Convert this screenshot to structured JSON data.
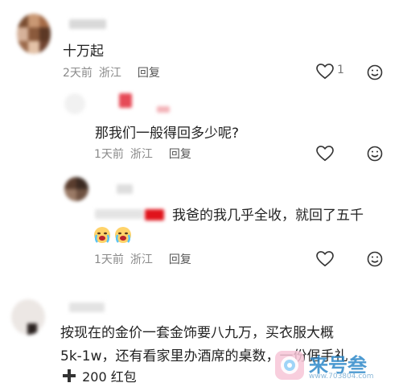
{
  "comments": [
    {
      "text": "十万起",
      "meta": {
        "time": "2天前",
        "region": "浙江",
        "reply": "回复"
      },
      "like_count": "1"
    },
    {
      "text": "那我们一般得回多少呢?",
      "meta": {
        "time": "1天前",
        "region": "浙江",
        "reply": "回复"
      }
    },
    {
      "text": "我爸的我几乎全收，就回了五千",
      "emoji_icon": "crying-face-icon",
      "meta": {
        "time": "1天前",
        "region": "浙江",
        "reply": "回复"
      }
    },
    {
      "text_line1": "按现在的金价一套金饰要八九万，买衣服大概",
      "text_line2": "5k-1w，还有看家里办酒席的桌数，一份倨手礼",
      "red_packet": "200 红包"
    }
  ],
  "watermark": {
    "name": "来号叁",
    "url": "www.703804.com"
  },
  "colors": {
    "meta_gray": "#8a8a8a",
    "text": "#222222",
    "red": "#e0131b"
  }
}
